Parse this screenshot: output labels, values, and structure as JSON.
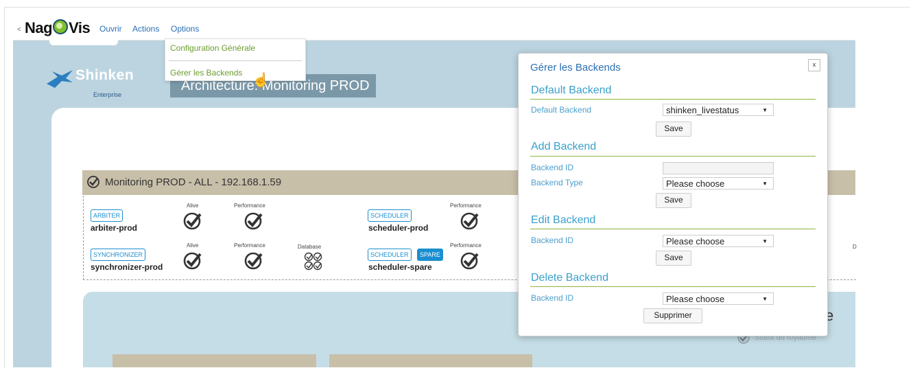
{
  "nav": {
    "collapse": "<",
    "logo_part1": "Nag",
    "logo_part2": "Vis",
    "menu": [
      "Ouvrir",
      "Actions",
      "Options"
    ],
    "dropdown": [
      "Configuration Générale",
      "Gérer les Backends"
    ]
  },
  "map": {
    "brand": "Shinken",
    "brand_tm": "-",
    "brand_sub": "Enterprise",
    "architecture_title": "Architecture: Monitoring PROD",
    "realm_title": "Monitoring PROD - ALL - 192.168.1.59",
    "labels": {
      "alive": "Alive",
      "performance": "Performance",
      "database": "Database"
    },
    "daemons": [
      {
        "type": "ARBITER",
        "name": "arbiter-prod"
      },
      {
        "type": "SYNCHRONIZER",
        "name": "synchronizer-prod"
      },
      {
        "type": "SCHEDULER",
        "name": "scheduler-prod"
      },
      {
        "type": "SCHEDULER",
        "spare": "SPARE",
        "name": "scheduler-spare"
      }
    ],
    "side_letter": "e",
    "edge_letter": "D",
    "realm_status": "Statut du royaume"
  },
  "dialog": {
    "title": "Gérer les Backends",
    "close": "x",
    "sections": {
      "default": "Default Backend",
      "add": "Add Backend",
      "edit": "Edit Backend",
      "delete": "Delete Backend"
    },
    "labels": {
      "default_backend": "Default Backend",
      "backend_id": "Backend ID",
      "backend_type": "Backend Type"
    },
    "values": {
      "default_backend": "shinken_livestatus",
      "backend_id": "",
      "backend_type": "Please choose",
      "edit_backend_id": "Please choose",
      "delete_backend_id": "Please choose"
    },
    "buttons": {
      "save": "Save",
      "delete": "Supprimer"
    }
  },
  "colors": {
    "accent": "#3aa0cc",
    "link": "#2a6fb5",
    "ok_green": "#8fb340",
    "badge_blue": "#1a8ed0"
  }
}
